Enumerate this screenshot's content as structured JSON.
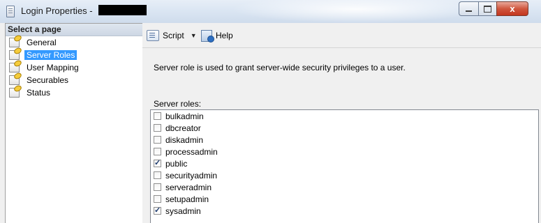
{
  "window": {
    "title": "Login Properties -",
    "controls": {
      "minimize_icon": "minimize-icon",
      "maximize_icon": "maximize-icon",
      "close_icon": "close-icon",
      "close_glyph": "x"
    }
  },
  "left_panel": {
    "header": "Select a page",
    "items": [
      {
        "label": "General",
        "icon": "page-wrench-icon",
        "selected": false
      },
      {
        "label": "Server Roles",
        "icon": "page-wrench-icon",
        "selected": true
      },
      {
        "label": "User Mapping",
        "icon": "page-wrench-icon",
        "selected": false
      },
      {
        "label": "Securables",
        "icon": "page-wrench-icon",
        "selected": false
      },
      {
        "label": "Status",
        "icon": "page-wrench-icon",
        "selected": false
      }
    ]
  },
  "toolbar": {
    "script_label": "Script",
    "help_label": "Help"
  },
  "main": {
    "description": "Server role is used to grant server-wide security privileges to a user.",
    "roles_label": "Server roles:",
    "roles": [
      {
        "name": "bulkadmin",
        "checked": false
      },
      {
        "name": "dbcreator",
        "checked": false
      },
      {
        "name": "diskadmin",
        "checked": false
      },
      {
        "name": "processadmin",
        "checked": false
      },
      {
        "name": "public",
        "checked": true
      },
      {
        "name": "securityadmin",
        "checked": false
      },
      {
        "name": "serveradmin",
        "checked": false
      },
      {
        "name": "setupadmin",
        "checked": false
      },
      {
        "name": "sysadmin",
        "checked": true
      }
    ]
  },
  "colors": {
    "selection": "#3399ff",
    "close_button": "#c8452f"
  }
}
